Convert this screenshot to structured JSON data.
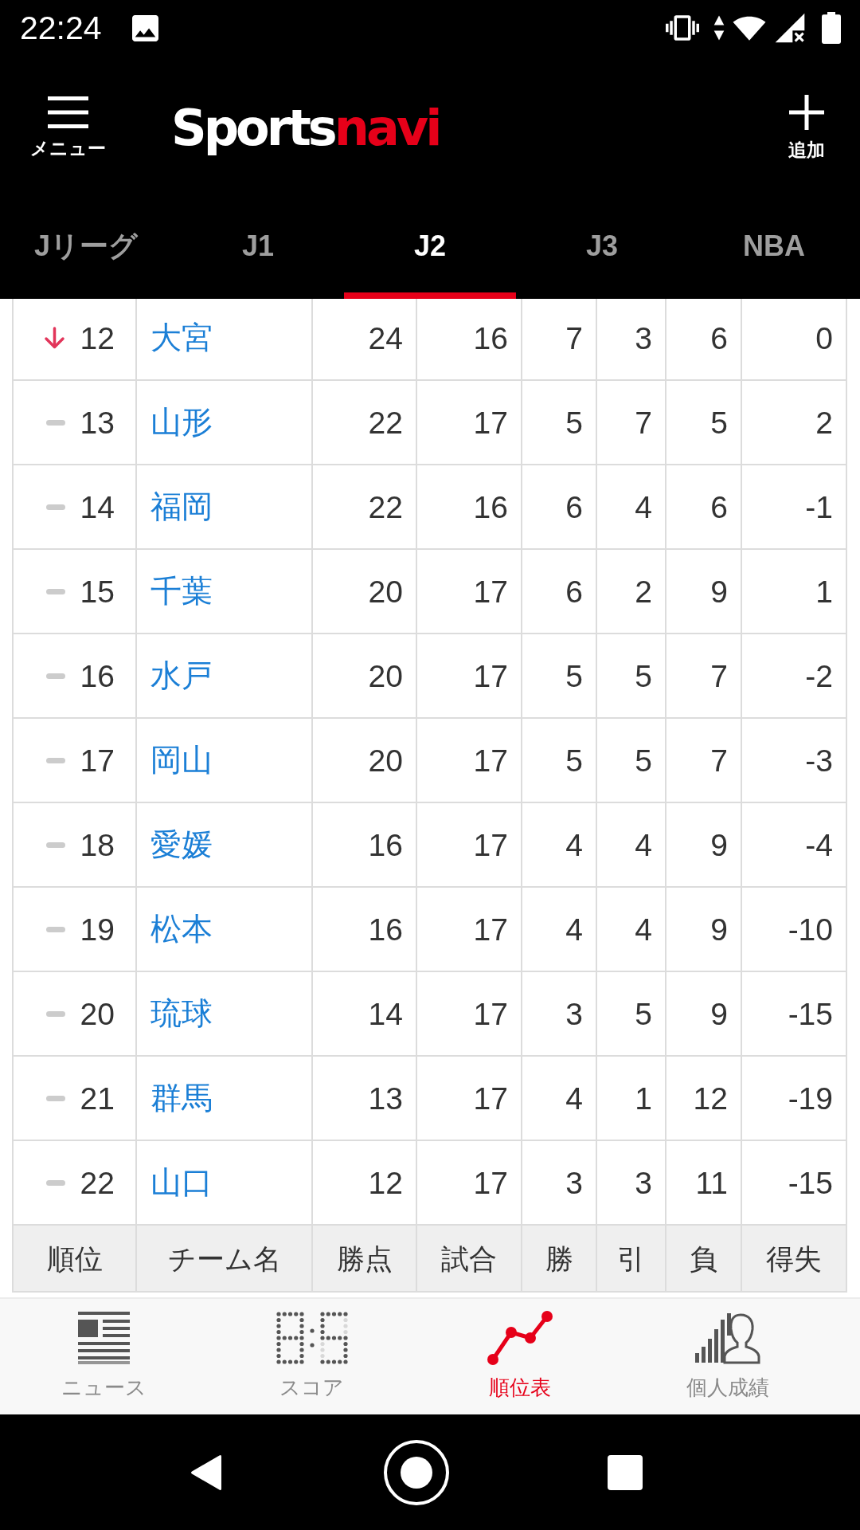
{
  "status_bar": {
    "time": "22:24"
  },
  "header": {
    "menu_label": "メニュー",
    "logo": {
      "part_1": "Sports",
      "part_2": "navi"
    },
    "add_label": "追加"
  },
  "tabs": [
    {
      "label": "Jリーグ",
      "selected": false
    },
    {
      "label": "J1",
      "selected": false
    },
    {
      "label": "J2",
      "selected": true
    },
    {
      "label": "J3",
      "selected": false
    },
    {
      "label": "NBA",
      "selected": false
    }
  ],
  "standings": {
    "columns": [
      "順位",
      "チーム名",
      "勝点",
      "試合",
      "勝",
      "引",
      "負",
      "得失"
    ],
    "rows": [
      {
        "moved_down": true,
        "rank": "12",
        "team": "大宮",
        "points": "24",
        "played": "16",
        "won": "7",
        "drawn": "3",
        "lost": "6",
        "goal_diff": "0"
      },
      {
        "moved_down": false,
        "rank": "13",
        "team": "山形",
        "points": "22",
        "played": "17",
        "won": "5",
        "drawn": "7",
        "lost": "5",
        "goal_diff": "2"
      },
      {
        "moved_down": false,
        "rank": "14",
        "team": "福岡",
        "points": "22",
        "played": "16",
        "won": "6",
        "drawn": "4",
        "lost": "6",
        "goal_diff": "-1"
      },
      {
        "moved_down": false,
        "rank": "15",
        "team": "千葉",
        "points": "20",
        "played": "17",
        "won": "6",
        "drawn": "2",
        "lost": "9",
        "goal_diff": "1"
      },
      {
        "moved_down": false,
        "rank": "16",
        "team": "水戸",
        "points": "20",
        "played": "17",
        "won": "5",
        "drawn": "5",
        "lost": "7",
        "goal_diff": "-2"
      },
      {
        "moved_down": false,
        "rank": "17",
        "team": "岡山",
        "points": "20",
        "played": "17",
        "won": "5",
        "drawn": "5",
        "lost": "7",
        "goal_diff": "-3"
      },
      {
        "moved_down": false,
        "rank": "18",
        "team": "愛媛",
        "points": "16",
        "played": "17",
        "won": "4",
        "drawn": "4",
        "lost": "9",
        "goal_diff": "-4"
      },
      {
        "moved_down": false,
        "rank": "19",
        "team": "松本",
        "points": "16",
        "played": "17",
        "won": "4",
        "drawn": "4",
        "lost": "9",
        "goal_diff": "-10"
      },
      {
        "moved_down": false,
        "rank": "20",
        "team": "琉球",
        "points": "14",
        "played": "17",
        "won": "3",
        "drawn": "5",
        "lost": "9",
        "goal_diff": "-15"
      },
      {
        "moved_down": false,
        "rank": "21",
        "team": "群馬",
        "points": "13",
        "played": "17",
        "won": "4",
        "drawn": "1",
        "lost": "12",
        "goal_diff": "-19"
      },
      {
        "moved_down": false,
        "rank": "22",
        "team": "山口",
        "points": "12",
        "played": "17",
        "won": "3",
        "drawn": "3",
        "lost": "11",
        "goal_diff": "-15"
      }
    ]
  },
  "bottom_nav": [
    {
      "kind": "news",
      "label": "ニュース",
      "selected": false
    },
    {
      "kind": "score",
      "label": "スコア",
      "selected": false
    },
    {
      "kind": "standings",
      "label": "順位表",
      "selected": true
    },
    {
      "kind": "players",
      "label": "個人成績",
      "selected": false
    }
  ]
}
